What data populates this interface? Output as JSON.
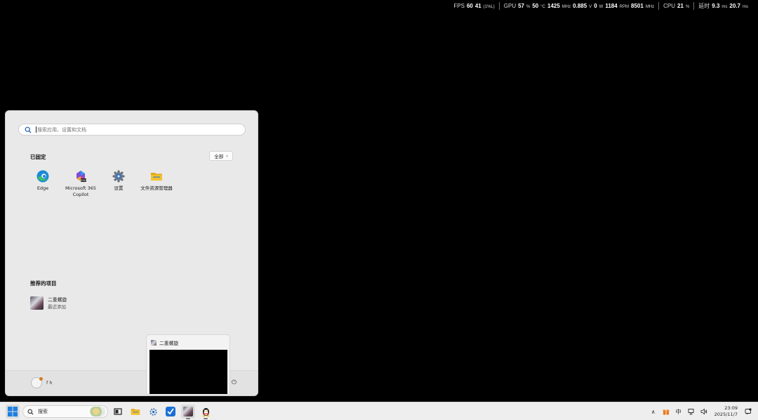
{
  "perf_overlay": {
    "fps_label": "FPS",
    "fps_value": "60",
    "fps_low": "41",
    "fps_low_unit": "(1%L)",
    "gpu_label": "GPU",
    "gpu_usage": "57",
    "gpu_usage_unit": "%",
    "gpu_temp": "50",
    "gpu_temp_unit": "°C",
    "gpu_clock": "1425",
    "gpu_clock_unit": "MHz",
    "gpu_voltage": "0.885",
    "gpu_voltage_unit": "V",
    "gpu_power": "0",
    "gpu_power_unit": "W",
    "fan_rpm": "1184",
    "fan_rpm_unit": "RPM",
    "mem_clock": "8501",
    "mem_clock_unit": "MHz",
    "cpu_label": "CPU",
    "cpu_usage": "21",
    "cpu_usage_unit": "%",
    "latency_label": "延时",
    "latency_1": "9.3",
    "latency_1_unit": "ms",
    "latency_2": "20.7",
    "latency_2_unit": "ms"
  },
  "start_menu": {
    "search_placeholder": "搜索应用、设置和文档",
    "pinned_title": "已固定",
    "all_button": "全部",
    "all_chevron": "›",
    "pinned_apps": [
      {
        "label": "Edge",
        "icon": "edge-icon"
      },
      {
        "label": "Microsoft 365 Copilot",
        "icon": "m365-copilot-icon"
      },
      {
        "label": "设置",
        "icon": "settings-gear-icon"
      },
      {
        "label": "文件资源管理器",
        "icon": "folder-icon"
      }
    ],
    "recommended_title": "推荐的项目",
    "recommended": [
      {
        "title": "二重螺旋",
        "subtitle": "最近添加"
      }
    ],
    "user_name": "f h",
    "power_glyph": "⏻"
  },
  "preview": {
    "title": "二重螺旋"
  },
  "taskbar": {
    "search_label": "搜索",
    "tray": {
      "chevron": "∧",
      "ime": "中",
      "time": "23:09",
      "date": "2025/11/7"
    }
  },
  "colors": {
    "edge_blue": "#1a8ad8",
    "edge_green": "#3fbe62",
    "folder_yellow": "#f5c02b",
    "windows_blue": "#1d7fe0"
  }
}
